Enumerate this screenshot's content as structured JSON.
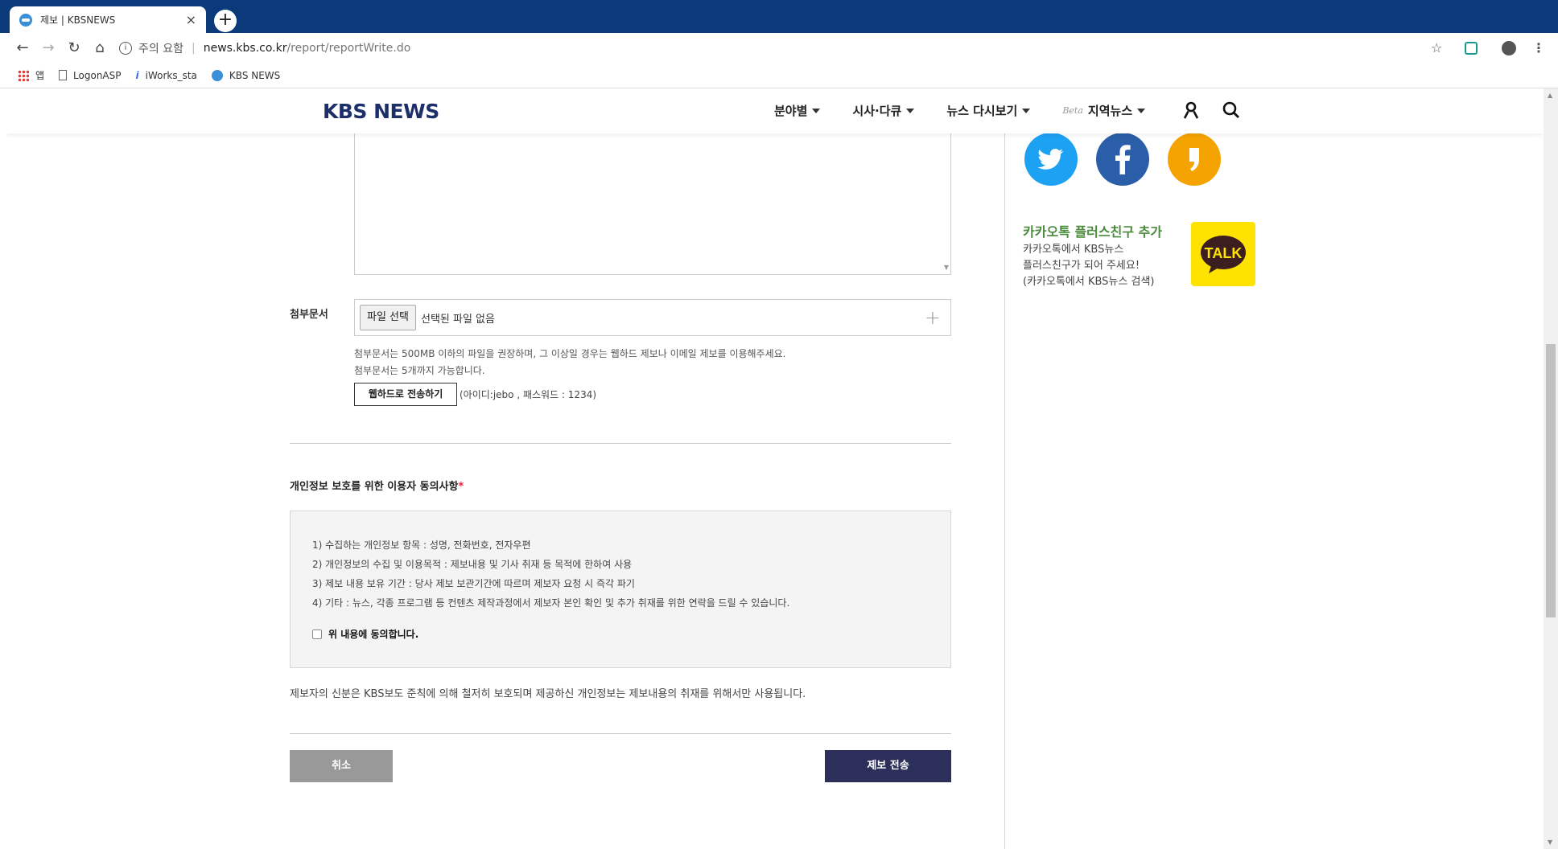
{
  "browser": {
    "tab_title": "제보 | KBSNEWS",
    "tab_close": "×",
    "new_tab": "+",
    "security_label": "주의 요함",
    "url_host": "news.kbs.co.kr",
    "url_path": "/report/reportWrite.do",
    "bookmarks": [
      {
        "label": "앱",
        "icon": "apps-grid-icon"
      },
      {
        "label": "LogonASP",
        "icon": "page-icon"
      },
      {
        "label": "iWorks_sta",
        "icon": "iworks-icon"
      },
      {
        "label": "KBS NEWS",
        "icon": "kbs-icon"
      }
    ]
  },
  "header": {
    "logo": "KBS NEWS",
    "nav": [
      {
        "label": "분야별"
      },
      {
        "label": "시사·다큐"
      },
      {
        "label": "뉴스 다시보기"
      },
      {
        "label": "지역뉴스",
        "badge": "Beta"
      }
    ]
  },
  "form": {
    "attach_label": "첨부문서",
    "file_button": "파일 선택",
    "file_status": "선택된 파일 없음",
    "file_add": "+",
    "help_lines": [
      "첨부문서는 500MB 이하의 파일을 권장하며, 그 이상일 경우는 웹하드 제보나 이메일 제보를 이용해주세요.",
      "첨부문서는 5개까지 가능합니다."
    ],
    "webhard_button": "웹하드로 전송하기",
    "webhard_info": "(아이디:jebo , 패스워드 : 1234)",
    "privacy_title": "개인정보 보호를 위한 이용자 동의사항",
    "required_mark": "*",
    "consent_lines": [
      "1) 수집하는 개인정보 항목 : 성명, 전화번호, 전자우편",
      "2) 개인정보의 수집 및 이용목적 : 제보내용 및 기사 취재 등 목적에 한하여 사용",
      "3) 제보 내용 보유 기간 : 당사 제보 보관기간에 따르며 제보자 요청 시 즉각 파기",
      "4) 기타 : 뉴스, 각종 프로그램 등 컨텐츠 제작과정에서 제보자 본인 확인 및 추가 취재를 위한 연락을 드릴 수 있습니다."
    ],
    "agree_label": "위 내용에 동의합니다.",
    "notice": "제보자의 신분은 KBS보도 준칙에 의해 철저히 보호되며 제공하신 개인정보는 제보내용의 취재를 위해서만 사용됩니다.",
    "cancel_button": "취소",
    "submit_button": "제보 전송"
  },
  "sidebar": {
    "kakao_title": "카카오톡 플러스친구 추가",
    "kakao_desc": [
      "카카오톡에서 KBS뉴스",
      "플러스친구가 되어 주세요!",
      "(카카오톡에서 KBS뉴스 검색)"
    ],
    "talk_label": "TALK"
  },
  "colors": {
    "brand_navy": "#1d2f6b",
    "submit_bg": "#2b2f5a",
    "cancel_bg": "#999999",
    "twitter": "#1da1f2",
    "facebook": "#2a5ea8",
    "kakaostory": "#f5a300",
    "kakaotalk": "#ffe300",
    "kakao_title": "#4a8a3c",
    "chrome_frame": "#0b3a7a"
  }
}
